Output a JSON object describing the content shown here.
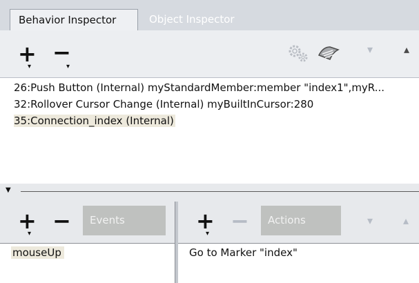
{
  "tabs": [
    {
      "label": "Behavior Inspector",
      "active": true
    },
    {
      "label": "Object Inspector",
      "active": false
    }
  ],
  "toolbar": {
    "add_symbol": "+",
    "remove_symbol": "−",
    "gear_icon": "gears-icon",
    "script_icon": "script-icon",
    "move_down_symbol": "▾",
    "move_up_symbol": "▴"
  },
  "behaviors": [
    {
      "text": "26:Push Button (Internal) myStandardMember:member \"index1\",myR..."
    },
    {
      "text": "32:Rollover Cursor Change (Internal) myBuiltInCursor:280"
    },
    {
      "text": "35:Connection_index (Internal)",
      "selected": true
    }
  ],
  "events": {
    "label": "Events",
    "items": [
      "mouseUp"
    ]
  },
  "actions": {
    "label": "Actions",
    "items": [
      "Go to Marker \"index\""
    ]
  },
  "colors": {
    "tab_strip": "#d6dae0",
    "toolbar": "#eceef1",
    "selection": "#ede9dc",
    "label_box": "#bfc1bf"
  }
}
